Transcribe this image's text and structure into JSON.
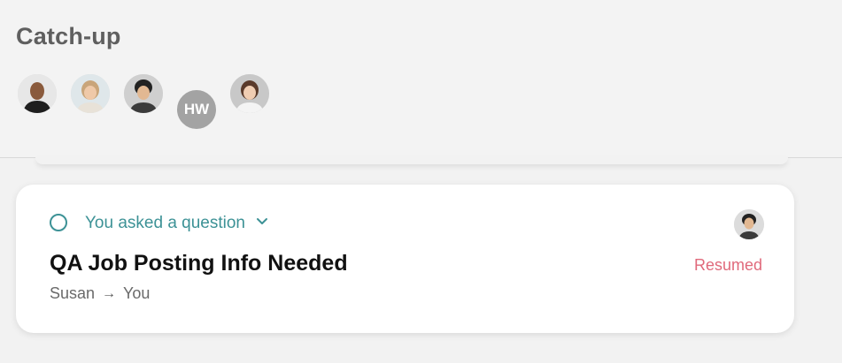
{
  "header": {
    "title": "Catch-up",
    "avatars": [
      {
        "name": "avatar-person-1",
        "type": "photo"
      },
      {
        "name": "avatar-person-2",
        "type": "photo"
      },
      {
        "name": "avatar-person-3",
        "type": "photo"
      },
      {
        "name": "avatar-hw",
        "type": "initials",
        "initials": "HW"
      },
      {
        "name": "avatar-person-5",
        "type": "photo"
      }
    ]
  },
  "card": {
    "status_label": "You asked a question",
    "title": "QA Job Posting Info Needed",
    "from": "Susan",
    "arrow": "→",
    "to": "You",
    "state": "Resumed"
  },
  "colors": {
    "accent_teal": "#3d9296",
    "resumed_red": "#e0697b"
  }
}
